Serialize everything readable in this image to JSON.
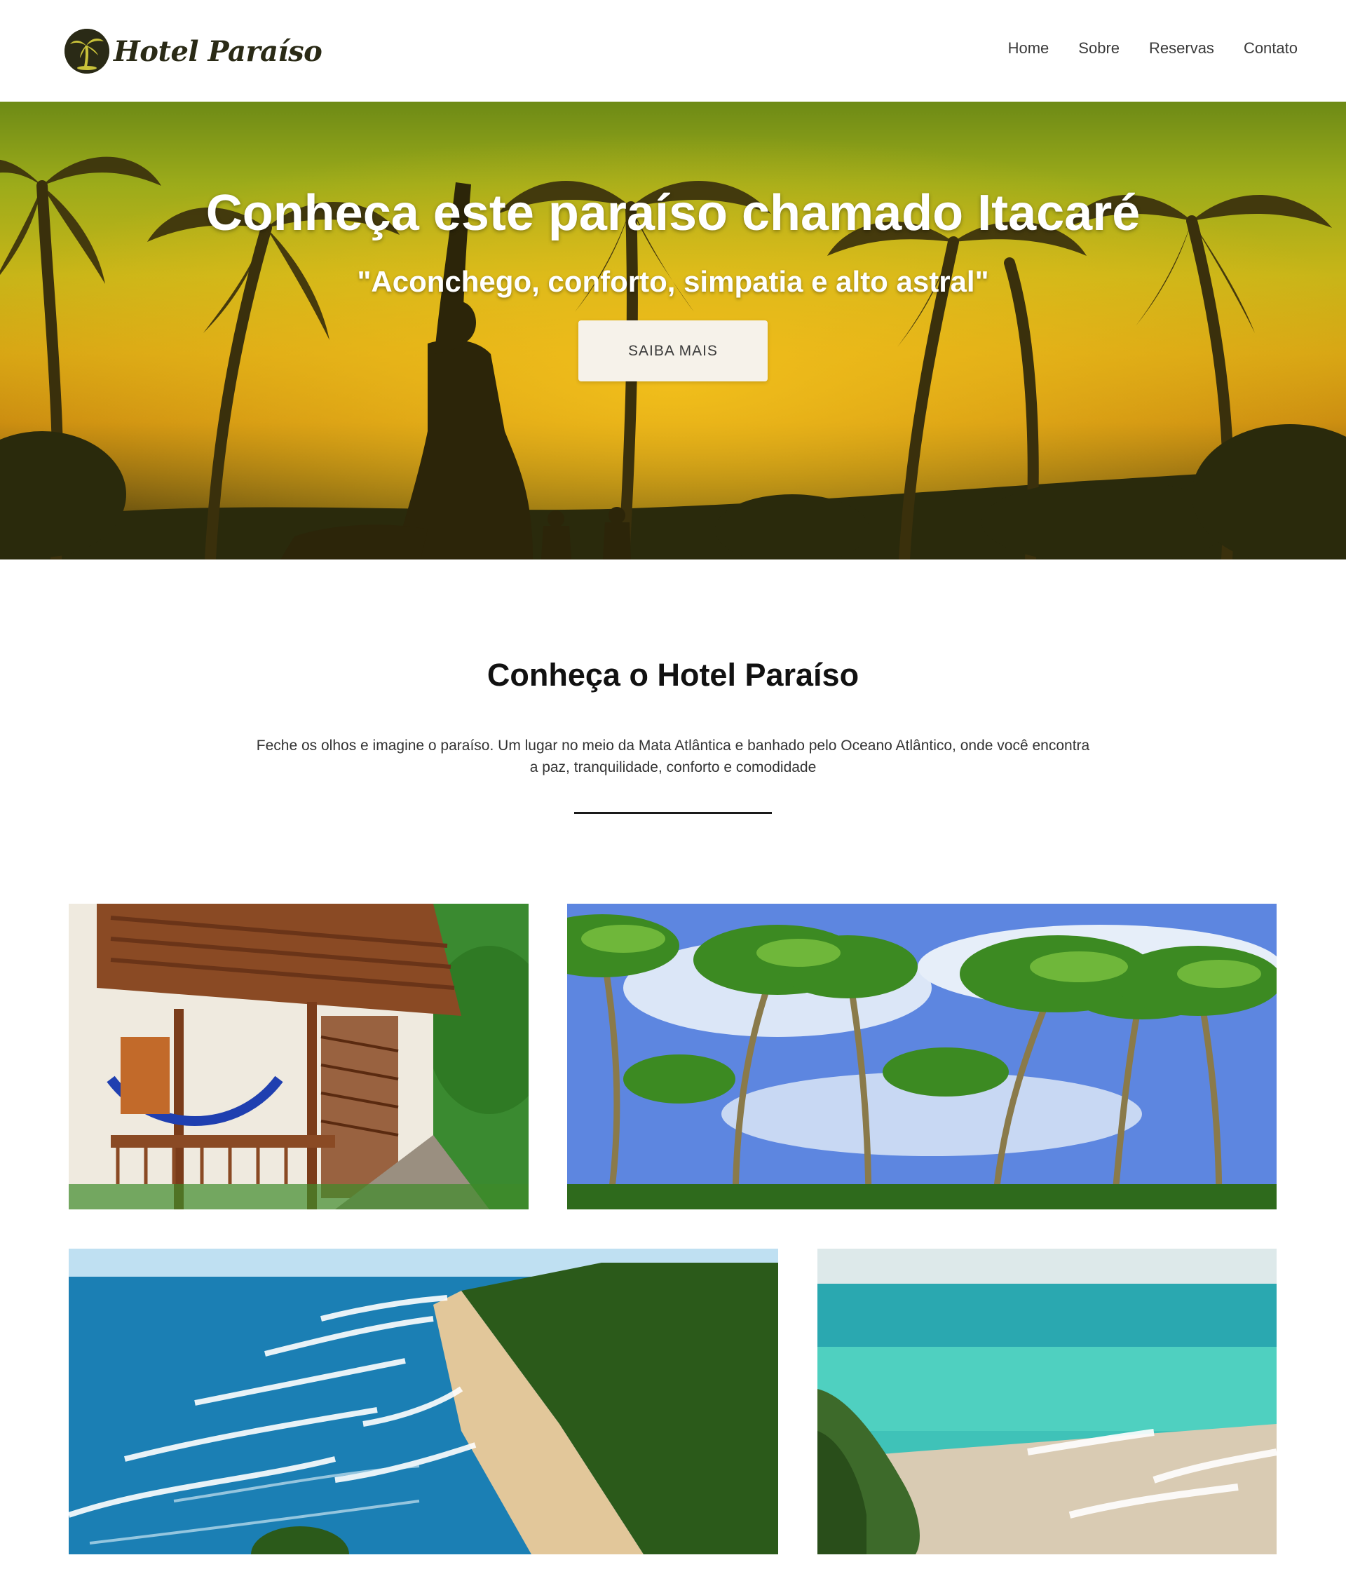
{
  "header": {
    "logo_text": "Hotel Paraíso",
    "logo_icon": "palm-tree-icon",
    "nav": [
      {
        "label": "Home"
      },
      {
        "label": "Sobre"
      },
      {
        "label": "Reservas"
      },
      {
        "label": "Contato"
      }
    ]
  },
  "hero": {
    "title": "Conheça este paraíso chamado Itacaré",
    "subtitle": "\"Aconchego, conforto, simpatia e alto astral\"",
    "button_label": "SAIBA MAIS"
  },
  "about": {
    "title": "Conheça o Hotel Paraíso",
    "text": "Feche os olhos e imagine o paraíso. Um lugar no meio da Mata Atlântica e banhado pelo Oceano Atlântico, onde você encontra a paz, tranquilidade, conforto e comodidade"
  },
  "colors": {
    "logo": "#2a2a16",
    "button_bg": "#f6f2ea",
    "divider": "#1a1a1a"
  }
}
